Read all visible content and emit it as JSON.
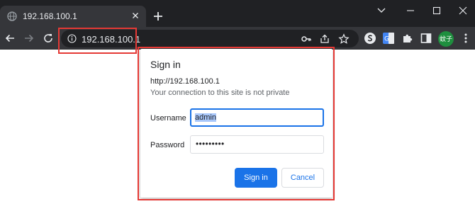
{
  "browser": {
    "tab": {
      "title": "192.168.100.1",
      "favicon": "globe-icon"
    },
    "window_controls": [
      "chevron-down-icon",
      "minimize-icon",
      "maximize-icon",
      "close-icon"
    ],
    "address_bar": {
      "url": "192.168.100.1",
      "security_icon": "info-icon"
    },
    "omnibox_actions": [
      "key-icon",
      "share-icon",
      "bookmark-star-icon"
    ],
    "extensions": [
      "extension-s-icon",
      "translate-icon",
      "puzzle-icon",
      "sidepanel-icon"
    ],
    "profile": {
      "label": "蚊子",
      "color": "#1e8e3e"
    },
    "menu_icon": "more-vert-icon",
    "colors": {
      "frame": "#202124",
      "toolbar": "#35363a",
      "highlight": "#e53935"
    }
  },
  "dialog": {
    "title": "Sign in",
    "origin": "http://192.168.100.1",
    "warning": "Your connection to this site is not private",
    "username": {
      "label": "Username",
      "value": "admin"
    },
    "password": {
      "label": "Password",
      "masked": "•••••••••"
    },
    "buttons": {
      "sign_in": "Sign in",
      "cancel": "Cancel"
    },
    "colors": {
      "primary": "#1a73e8",
      "focus": "#1a73e8",
      "selection": "#a8c7fa"
    }
  }
}
